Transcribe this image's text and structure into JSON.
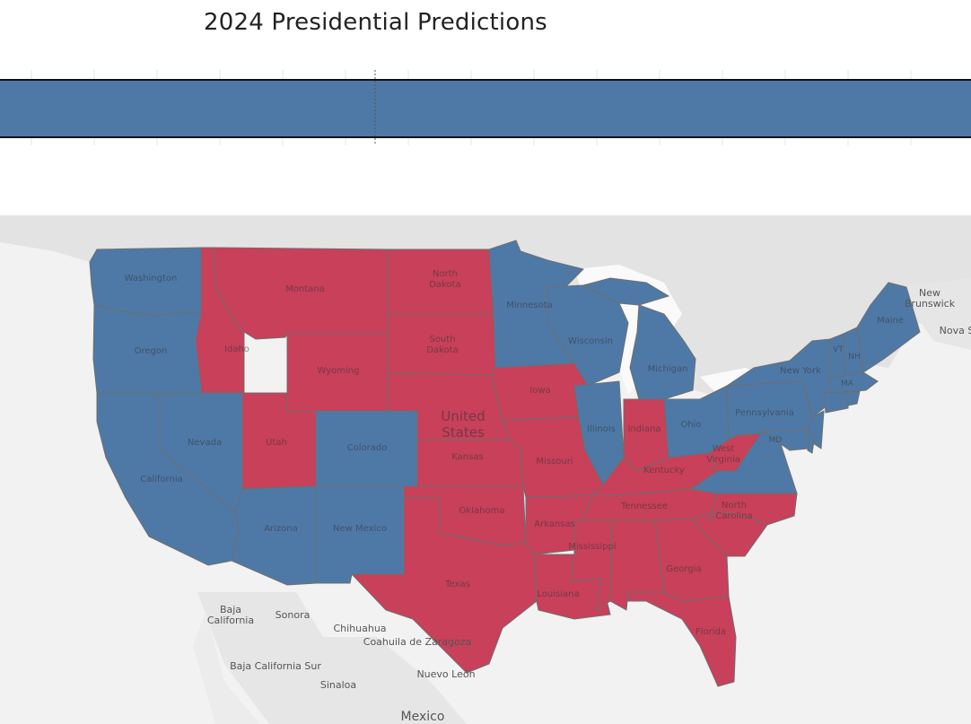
{
  "title": "2024 Presidential Predictions",
  "colors": {
    "dem": "#4e79a7",
    "rep": "#c8405a",
    "land": "#e6e6e6",
    "water": "#f6f6f6",
    "border": "#6e6e6e"
  },
  "state_results": {
    "Washington": "dem",
    "Oregon": "dem",
    "California": "dem",
    "Nevada": "dem",
    "Arizona": "dem",
    "New Mexico": "dem",
    "Colorado": "dem",
    "Minnesota": "dem",
    "Wisconsin": "dem",
    "Michigan": "dem",
    "Illinois": "dem",
    "Ohio": "dem",
    "Pennsylvania": "dem",
    "Virginia": "dem",
    "New York": "dem",
    "Maine": "dem",
    "VT": "dem",
    "NH": "dem",
    "MA": "dem",
    "CT": "dem",
    "NJ": "dem",
    "MD": "dem",
    "DE": "dem",
    "Idaho": "rep",
    "Montana": "rep",
    "Wyoming": "rep",
    "Utah": "rep",
    "North Dakota": "rep",
    "South Dakota": "rep",
    "Nebraska": "rep",
    "Kansas": "rep",
    "Oklahoma": "rep",
    "Texas": "rep",
    "Iowa": "rep",
    "Missouri": "rep",
    "Arkansas": "rep",
    "Louisiana": "rep",
    "Mississippi": "rep",
    "Alabama": "rep",
    "Tennessee": "rep",
    "Kentucky": "rep",
    "Indiana": "rep",
    "West Virginia": "rep",
    "North Carolina": "rep",
    "South Carolina": "rep",
    "Georgia": "rep",
    "Florida": "rep"
  },
  "labels": {
    "washington": "Washington",
    "oregon": "Oregon",
    "california": "California",
    "nevada": "Nevada",
    "idaho": "Idaho",
    "montana": "Montana",
    "wyoming": "Wyoming",
    "utah": "Utah",
    "colorado": "Colorado",
    "arizona": "Arizona",
    "new_mexico": "New Mexico",
    "north_dakota": "North Dakota",
    "south_dakota": "South Dakota",
    "kansas": "Kansas",
    "oklahoma": "Oklahoma",
    "texas": "Texas",
    "minnesota": "Minnesota",
    "iowa": "Iowa",
    "missouri": "Missouri",
    "arkansas": "Arkansas",
    "louisiana": "Louisiana",
    "wisconsin": "Wisconsin",
    "illinois": "Illinois",
    "michigan": "Michigan",
    "indiana": "Indiana",
    "ohio": "Ohio",
    "kentucky": "Kentucky",
    "tennessee": "Tennessee",
    "mississippi": "Mississippi",
    "georgia": "Georgia",
    "florida": "Florida",
    "west_virginia": "West Virginia",
    "north_carolina": "North Carolina",
    "pennsylvania": "Pennsylvania",
    "new_york": "New York",
    "maine": "Maine",
    "vt": "VT",
    "nh": "NH",
    "ma": "MA",
    "md": "MD",
    "united_states": "United States",
    "baja_california": "Baja California",
    "sonora": "Sonora",
    "chihuahua": "Chihuahua",
    "coahuila": "Coahuila de Zaragoza",
    "nuevo_leon": "Nuevo León",
    "baja_california_sur": "Baja California Sur",
    "sinaloa": "Sinaloa",
    "mexico": "Mexico",
    "new_brunswick": "New Brunswick",
    "nova_scotia": "Nova S"
  }
}
